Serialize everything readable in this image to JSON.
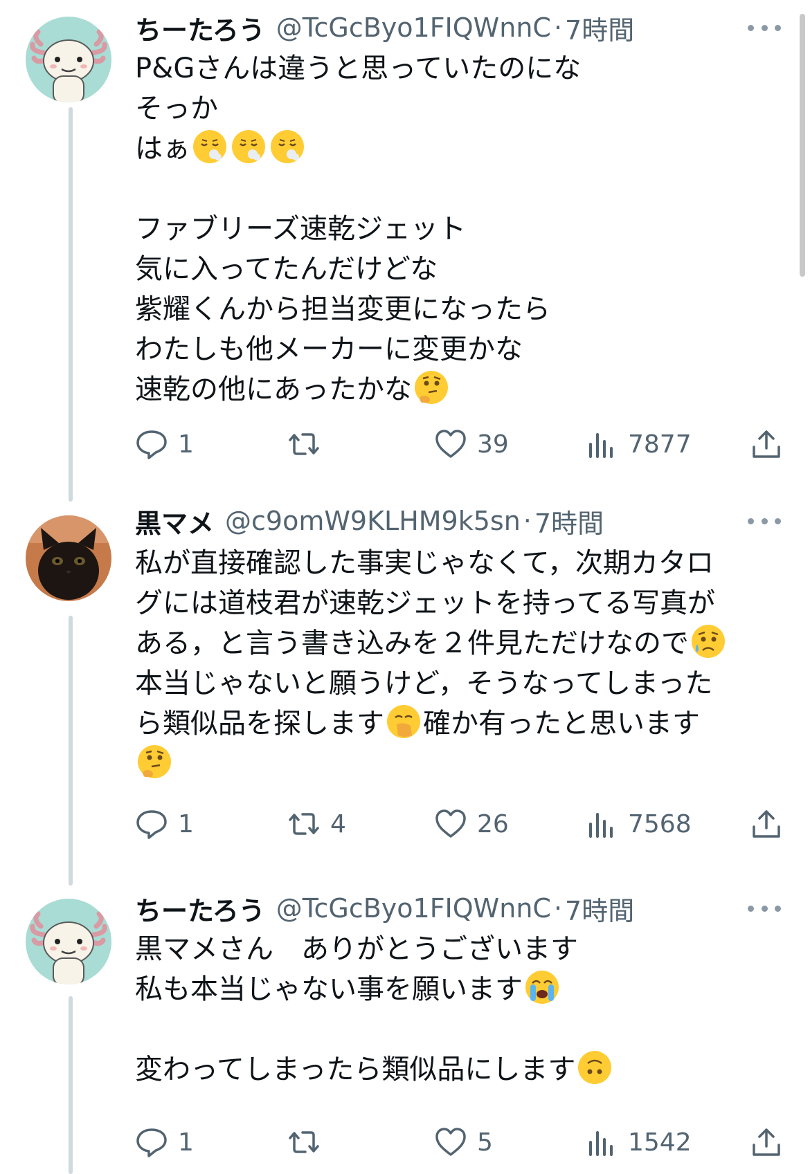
{
  "tweets": [
    {
      "name": "ちーたろう",
      "handle": "@TcGcByo1FIQWnnC",
      "separator": "·",
      "time": "7時間",
      "lines": [
        [
          "P&Gさんは違うと思っていたのにな"
        ],
        [
          "そっか"
        ],
        [
          "はぁ",
          ""
        ],
        [
          ""
        ],
        [
          "ファブリーズ速乾ジェット"
        ],
        [
          "気に入ってたんだけどな"
        ],
        [
          "紫耀くんから担当変更になったら"
        ],
        [
          "わたしも他メーカーに変更かな"
        ],
        [
          "速乾の他にあったかな"
        ]
      ],
      "emojis": [
        "exhale-face-emoji",
        "exhale-face-emoji",
        "exhale-face-emoji",
        "thinking-face-emoji"
      ],
      "replies": "1",
      "retweets": "",
      "likes": "39",
      "views": "7877"
    },
    {
      "name": "黒マメ",
      "handle": "@c9omW9KLHM9k5sn",
      "separator": "·",
      "time": "7時間",
      "lines": [
        [
          "私が直接確認した事実じゃなくて，次期カタロ"
        ],
        [
          "グには道枝君が速乾ジェットを持ってる写真が"
        ],
        [
          "ある，と言う書き込みを２件見ただけなので"
        ],
        [
          "本当じゃないと願うけど，そうなってしまった"
        ],
        [
          "ら類似品を探します",
          "確か有ったと思います"
        ],
        [
          ""
        ]
      ],
      "emojis": [
        "sad-but-relieved-face-emoji",
        "face-with-hand-over-mouth-emoji",
        "thinking-face-emoji"
      ],
      "replies": "1",
      "retweets": "4",
      "likes": "26",
      "views": "7568"
    },
    {
      "name": "ちーたろう",
      "handle": "@TcGcByo1FIQWnnC",
      "separator": "·",
      "time": "7時間",
      "lines": [
        [
          "黒マメさん　ありがとうございます"
        ],
        [
          "私も本当じゃない事を願います"
        ],
        [
          ""
        ],
        [
          "変わってしまったら類似品にします"
        ]
      ],
      "emojis": [
        "loudly-crying-face-emoji",
        "upside-down-face-emoji"
      ],
      "replies": "1",
      "retweets": "",
      "likes": "5",
      "views": "1542"
    }
  ],
  "colors": {
    "text": "#0f1419",
    "secondary": "#536471",
    "thread_line": "#cfd9de",
    "avatar_axolotl_bg": "#a8dcd4",
    "emoji_yellow": "#ffcc33"
  }
}
